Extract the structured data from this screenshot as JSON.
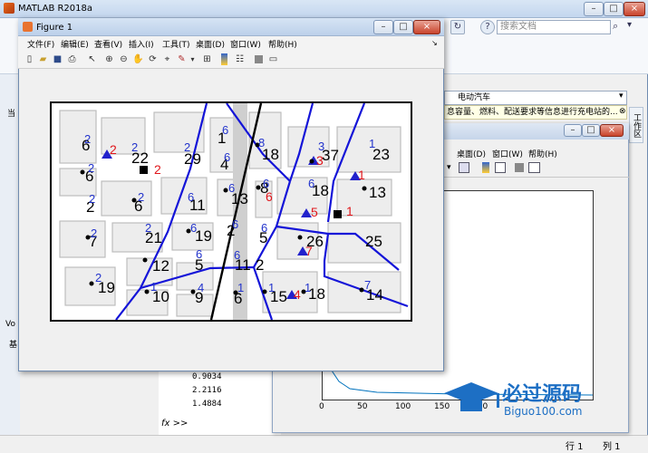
{
  "main": {
    "title": "MATLAB R2018a",
    "search_placeholder": "搜索文档",
    "address": "电动汽车",
    "message": "息容量、燃料、配送要求等信息进行充电站的...",
    "side_tab": "工作区",
    "cmd_values": [
      "0.9034",
      "2.2116",
      "1.4884"
    ],
    "fx": "fx >>",
    "status_row": "行 1",
    "status_col": "列 1",
    "left_labels": [
      "当",
      "Vo",
      "基"
    ]
  },
  "fig1": {
    "title": "Figure 1",
    "menu": [
      "文件(F)",
      "编辑(E)",
      "查看(V)",
      "插入(I)",
      "工具(T)",
      "桌面(D)",
      "窗口(W)",
      "帮助(H)"
    ]
  },
  "fig2": {
    "menu": [
      "桌面(D)",
      "窗口(W)",
      "帮助(H)"
    ],
    "xticks": [
      "0",
      "50",
      "100",
      "150",
      "200"
    ]
  },
  "plot": {
    "black_labels": [
      {
        "t": "6",
        "x": 90,
        "y": 166
      },
      {
        "t": "22",
        "x": 145,
        "y": 180
      },
      {
        "t": "29",
        "x": 203,
        "y": 181
      },
      {
        "t": "1",
        "x": 240,
        "y": 158
      },
      {
        "t": "4",
        "x": 243,
        "y": 187
      },
      {
        "t": "18",
        "x": 289,
        "y": 176
      },
      {
        "t": "37",
        "x": 355,
        "y": 177
      },
      {
        "t": "23",
        "x": 411,
        "y": 176
      },
      {
        "t": "6",
        "x": 94,
        "y": 200
      },
      {
        "t": "2",
        "x": 95,
        "y": 234
      },
      {
        "t": "6",
        "x": 148,
        "y": 233
      },
      {
        "t": "11",
        "x": 209,
        "y": 232
      },
      {
        "t": "13",
        "x": 255,
        "y": 225
      },
      {
        "t": "8",
        "x": 287,
        "y": 213
      },
      {
        "t": "18",
        "x": 344,
        "y": 216
      },
      {
        "t": "13",
        "x": 407,
        "y": 218
      },
      {
        "t": "7",
        "x": 98,
        "y": 272
      },
      {
        "t": "21",
        "x": 160,
        "y": 268
      },
      {
        "t": "19",
        "x": 215,
        "y": 266
      },
      {
        "t": "2",
        "x": 250,
        "y": 260
      },
      {
        "t": "5",
        "x": 286,
        "y": 268
      },
      {
        "t": "26",
        "x": 338,
        "y": 272
      },
      {
        "t": "25",
        "x": 403,
        "y": 272
      },
      {
        "t": "12",
        "x": 168,
        "y": 299
      },
      {
        "t": "5",
        "x": 215,
        "y": 298
      },
      {
        "t": "11",
        "x": 259,
        "y": 298
      },
      {
        "t": "2",
        "x": 282,
        "y": 298
      },
      {
        "t": "19",
        "x": 108,
        "y": 323
      },
      {
        "t": "10",
        "x": 168,
        "y": 333
      },
      {
        "t": "9",
        "x": 215,
        "y": 334
      },
      {
        "t": "6",
        "x": 258,
        "y": 335
      },
      {
        "t": "15",
        "x": 298,
        "y": 333
      },
      {
        "t": "18",
        "x": 340,
        "y": 330
      },
      {
        "t": "14",
        "x": 404,
        "y": 331
      }
    ],
    "red_labels": [
      {
        "t": "2",
        "x": 121,
        "y": 170
      },
      {
        "t": "2",
        "x": 170,
        "y": 192
      },
      {
        "t": "3",
        "x": 349,
        "y": 182
      },
      {
        "t": "6",
        "x": 293,
        "y": 222
      },
      {
        "t": "5",
        "x": 343,
        "y": 239
      },
      {
        "t": "1",
        "x": 382,
        "y": 238
      },
      {
        "t": "7",
        "x": 337,
        "y": 282
      },
      {
        "t": "4",
        "x": 324,
        "y": 330
      },
      {
        "t": "1",
        "x": 395,
        "y": 198
      }
    ],
    "blue_labels": [
      {
        "t": "2",
        "x": 93,
        "y": 158
      },
      {
        "t": "2",
        "x": 145,
        "y": 167
      },
      {
        "t": "2",
        "x": 203,
        "y": 167
      },
      {
        "t": "6",
        "x": 245,
        "y": 148
      },
      {
        "t": "6",
        "x": 247,
        "y": 178
      },
      {
        "t": "8",
        "x": 285,
        "y": 162
      },
      {
        "t": "3",
        "x": 351,
        "y": 166
      },
      {
        "t": "1",
        "x": 407,
        "y": 163
      },
      {
        "t": "2",
        "x": 97,
        "y": 190
      },
      {
        "t": "2",
        "x": 98,
        "y": 224
      },
      {
        "t": "2",
        "x": 152,
        "y": 222
      },
      {
        "t": "6",
        "x": 207,
        "y": 222
      },
      {
        "t": "6",
        "x": 252,
        "y": 212
      },
      {
        "t": "6",
        "x": 290,
        "y": 207
      },
      {
        "t": "6",
        "x": 340,
        "y": 207
      },
      {
        "t": "2",
        "x": 100,
        "y": 262
      },
      {
        "t": "2",
        "x": 160,
        "y": 256
      },
      {
        "t": "6",
        "x": 210,
        "y": 256
      },
      {
        "t": "6",
        "x": 256,
        "y": 252
      },
      {
        "t": "6",
        "x": 288,
        "y": 256
      },
      {
        "t": "6",
        "x": 216,
        "y": 285
      },
      {
        "t": "6",
        "x": 258,
        "y": 286
      },
      {
        "t": "2",
        "x": 105,
        "y": 311
      },
      {
        "t": "1",
        "x": 166,
        "y": 321
      },
      {
        "t": "4",
        "x": 218,
        "y": 322
      },
      {
        "t": "1",
        "x": 262,
        "y": 322
      },
      {
        "t": "1",
        "x": 296,
        "y": 322
      },
      {
        "t": "1",
        "x": 336,
        "y": 322
      },
      {
        "t": "7",
        "x": 402,
        "y": 319
      }
    ]
  }
}
